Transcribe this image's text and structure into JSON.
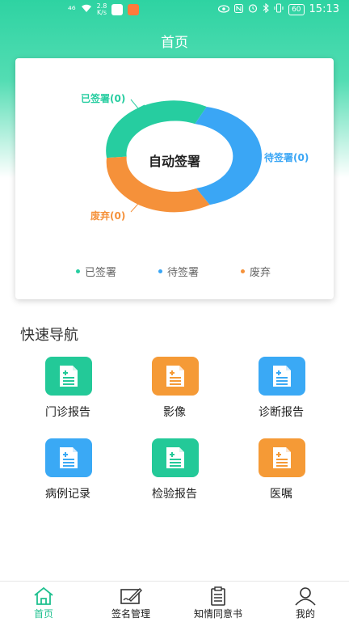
{
  "status_bar": {
    "network": "⁴⁶",
    "rate_value": "2.8",
    "rate_unit": "K/s",
    "battery": "60",
    "time": "15:13"
  },
  "header": {
    "title": "首页"
  },
  "chart_data": {
    "type": "pie",
    "center_label": "自动签署",
    "categories": [
      "已签署",
      "待签署",
      "废弃"
    ],
    "values": [
      0,
      0,
      0
    ],
    "slice_labels": [
      "已签署(0)",
      "待签署(0)",
      "废弃(0)"
    ],
    "colors": [
      "#26cda0",
      "#3aa6f5",
      "#f5913a"
    ],
    "legend_position": "bottom"
  },
  "quick_nav": {
    "title": "快速导航",
    "items": [
      {
        "label": "门诊报告",
        "icon": "document-icon",
        "color": "#23c998"
      },
      {
        "label": "影像",
        "icon": "document-icon",
        "color": "#f59a36"
      },
      {
        "label": "诊断报告",
        "icon": "document-icon",
        "color": "#3aa9f5"
      },
      {
        "label": "病例记录",
        "icon": "document-icon",
        "color": "#3aa9f5"
      },
      {
        "label": "检验报告",
        "icon": "document-icon",
        "color": "#23c998"
      },
      {
        "label": "医嘱",
        "icon": "document-icon",
        "color": "#f59a36"
      }
    ]
  },
  "tabbar": {
    "items": [
      {
        "label": "首页",
        "icon": "home-icon",
        "active": true
      },
      {
        "label": "签名管理",
        "icon": "signature-icon",
        "active": false
      },
      {
        "label": "知情同意书",
        "icon": "clipboard-icon",
        "active": false
      },
      {
        "label": "我的",
        "icon": "user-icon",
        "active": false
      }
    ]
  },
  "colors": {
    "accent": "#23c998",
    "active_tab": "#1fc08f"
  }
}
